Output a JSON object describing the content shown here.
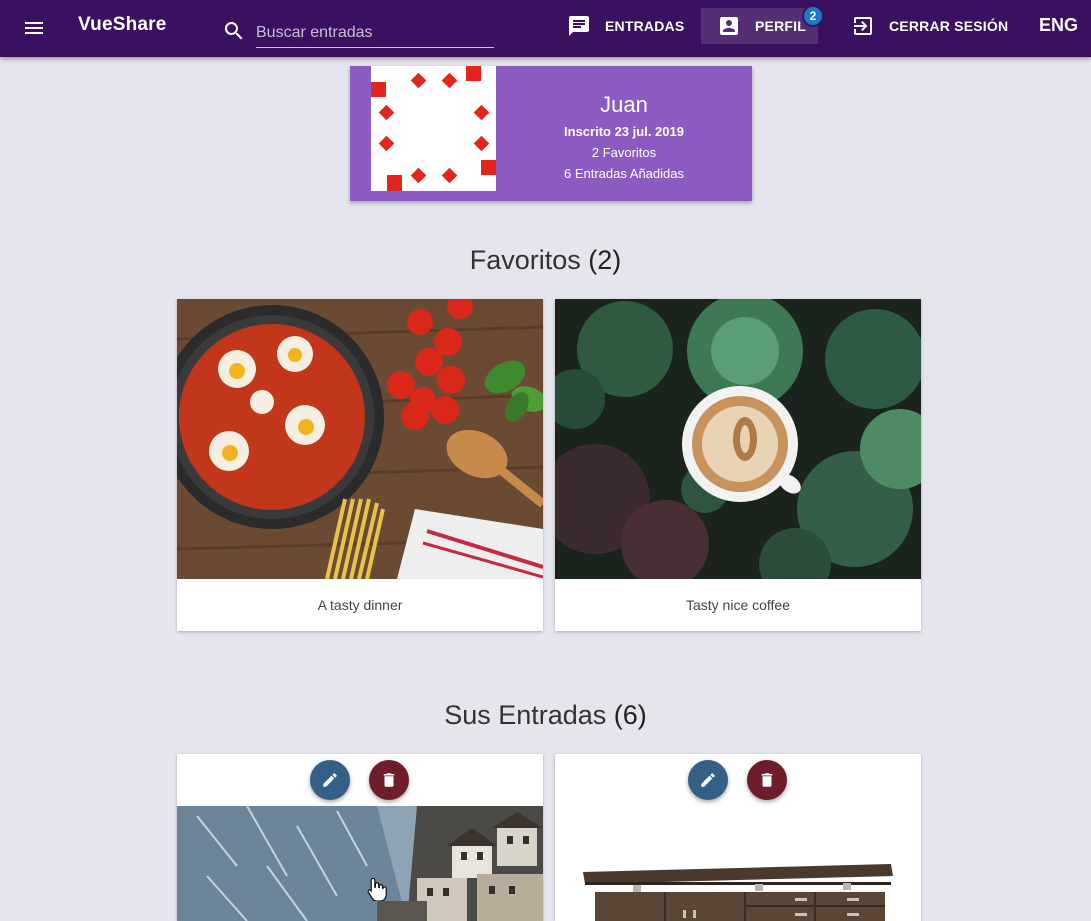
{
  "app": {
    "title": "VueShare"
  },
  "search": {
    "placeholder": "Buscar entradas"
  },
  "nav": {
    "entradas_label": "ENTRADAS",
    "perfil_label": "PERFIL",
    "perfil_badge": "2",
    "logout_label": "CERRAR SESIÓN",
    "language_label": "ENG"
  },
  "profile": {
    "name": "Juan",
    "joined": "Inscrito 23 jul. 2019",
    "favorites": "2 Favoritos",
    "entries": "6 Entradas Añadidas"
  },
  "favorites_section": {
    "title": "Favoritos",
    "count": "(2)",
    "cards": [
      {
        "caption": "A tasty dinner",
        "image": "shakshuka-pan-with-tomatoes-and-pasta"
      },
      {
        "caption": "Tasty nice coffee",
        "image": "latte-art-cup-among-succulents"
      }
    ]
  },
  "entries_section": {
    "title": "Sus Entradas",
    "count": "(6)",
    "cards": [
      {
        "image": "snowy-mountain-village"
      },
      {
        "image": "wooden-sideboard-furniture"
      }
    ]
  },
  "icons": {
    "menu": "hamburger-menu-icon",
    "search": "search-icon",
    "entradas": "chat-message-icon",
    "perfil": "account-box-icon",
    "logout": "exit-to-app-icon",
    "edit": "pencil-icon",
    "delete": "trash-icon"
  },
  "colors": {
    "toolbar": "#3a1160",
    "profile_card": "#8b5bc2",
    "badge": "#1e78c8",
    "edit_button": "#346088",
    "delete_button": "#6d1e2a",
    "background": "#e5e5ee"
  }
}
